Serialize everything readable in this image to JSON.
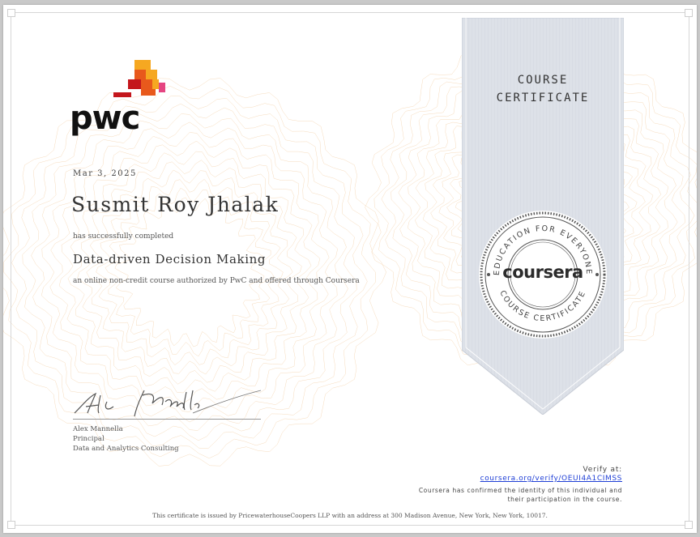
{
  "issuer": {
    "logo_text": "pwc"
  },
  "certificate": {
    "date": "Mar 3, 2025",
    "recipient_name": "Susmit Roy Jhalak",
    "completed_text": "has successfully completed",
    "course_name": "Data-driven Decision Making",
    "course_description": "an online non-credit course authorized by PwC and offered through Coursera"
  },
  "signer": {
    "name": "Alex Mannella",
    "title": "Principal",
    "department": "Data and Analytics Consulting"
  },
  "ribbon": {
    "title_line1": "COURSE",
    "title_line2": "CERTIFICATE"
  },
  "seal": {
    "wordmark": "coursera",
    "top_text": "EDUCATION FOR EVERYONE",
    "bottom_text": "COURSE CERTIFICATE"
  },
  "verify": {
    "label": "Verify at:",
    "link": "coursera.org/verify/OEUI4A1CIMSS",
    "note_line1": "Coursera has confirmed the identity of this individual and",
    "note_line2": "their participation in the course."
  },
  "footer": {
    "text": "This certificate is issued by PricewaterhouseCoopers LLP with an address at 300 Madison Avenue, New York, New York, 10017."
  },
  "colors": {
    "ribbon_fill": "#dde1e8",
    "link": "#1f3fd6",
    "guilloche": "#f3cfa6",
    "pwc_orange": "#e8591c",
    "pwc_red": "#c4161c",
    "pwc_yellow": "#f6a821",
    "pwc_pink": "#e54582"
  }
}
